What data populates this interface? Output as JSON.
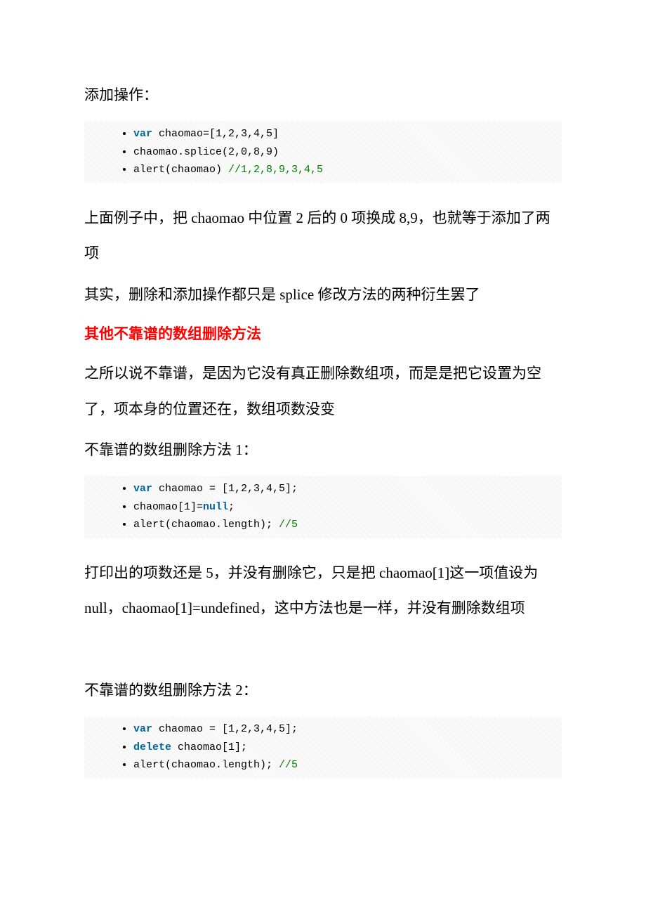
{
  "text": {
    "t1": "添加操作：",
    "t2": "上面例子中，把 chaomao 中位置 2 后的 0 项换成 8,9，也就等于添加了两项",
    "t3": "其实，删除和添加操作都只是 splice 修改方法的两种衍生罢了",
    "t4": "其他不靠谱的数组删除方法",
    "t5": "之所以说不靠谱，是因为它没有真正删除数组项，而是是把它设置为空了，项本身的位置还在，数组项数没变",
    "t6": "不靠谱的数组删除方法 1：",
    "t7": "打印出的项数还是 5，并没有删除它，只是把 chaomao[1]这一项值设为 null，chaomao[1]=undefined，这中方法也是一样，并没有删除数组项",
    "t8": "不靠谱的数组删除方法 2："
  },
  "code1": {
    "l1_kw": "var",
    "l1_rest": " chaomao=[1,2,3,4,5]",
    "l2": "chaomao.splice(2,0,8,9)",
    "l3_a": "alert(chaomao) ",
    "l3_cm": "//1,2,8,9,3,4,5"
  },
  "code2": {
    "l1_kw": "var",
    "l1_rest": " chaomao = [1,2,3,4,5];",
    "l2_a": "chaomao[1]=",
    "l2_kw": "null",
    "l2_c": ";",
    "l3_a": "alert(chaomao.length); ",
    "l3_cm": "//5"
  },
  "code3": {
    "l1_kw": "var",
    "l1_rest": " chaomao = [1,2,3,4,5];",
    "l2_kw": "delete",
    "l2_rest": " chaomao[1];",
    "l3_a": "alert(chaomao.length); ",
    "l3_cm": "//5"
  }
}
